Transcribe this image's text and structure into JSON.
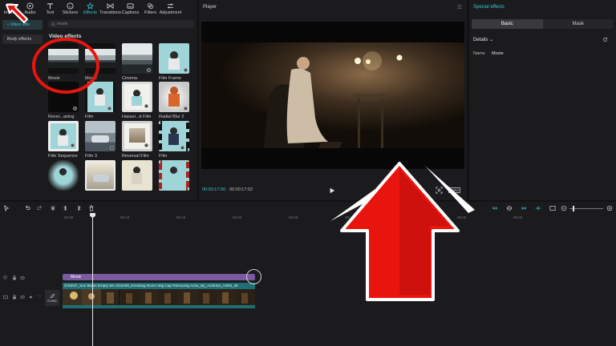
{
  "toolbar": {
    "items": [
      {
        "label": "Import",
        "icon": "import-icon"
      },
      {
        "label": "Audio",
        "icon": "audio-icon"
      },
      {
        "label": "Text",
        "icon": "text-icon"
      },
      {
        "label": "Stickers",
        "icon": "sticker-icon"
      },
      {
        "label": "Effects",
        "icon": "effects-icon",
        "active": true
      },
      {
        "label": "Transitions",
        "icon": "transitions-icon"
      },
      {
        "label": "Captions",
        "icon": "captions-icon"
      },
      {
        "label": "Filters",
        "icon": "filters-icon"
      },
      {
        "label": "Adjustment",
        "icon": "adjustment-icon"
      }
    ]
  },
  "left_nav": {
    "video_effects": "• Video effe",
    "body_effects": "Body effects"
  },
  "effects": {
    "search_value": "movie",
    "section_title": "Video effects",
    "cards": [
      {
        "label": "Movie"
      },
      {
        "label": "Movie"
      },
      {
        "label": "Cinema"
      },
      {
        "label": "Film Frame"
      },
      {
        "label": "Rever...aning"
      },
      {
        "label": "Film"
      },
      {
        "label": "Hassel...d Film"
      },
      {
        "label": "Radial Blur 2"
      },
      {
        "label": "Film Sequence"
      },
      {
        "label": "Film 3"
      },
      {
        "label": "Reversal Film"
      },
      {
        "label": "Film"
      },
      {
        "label": ""
      },
      {
        "label": ""
      },
      {
        "label": ""
      },
      {
        "label": ""
      }
    ]
  },
  "player": {
    "title": "Player",
    "current_time": "00:00:17:00",
    "total_time": "00:00:17:02",
    "ratio": "Ratio"
  },
  "right_panel": {
    "title": "Special effects",
    "tabs": [
      "Basic",
      "Mask"
    ],
    "details": "Details",
    "name_label": "Name",
    "name_value": "Movie"
  },
  "timeline": {
    "ruler": [
      "00:05",
      "00:10",
      "00:15",
      "00:20",
      "00:25",
      "00:30",
      "00:35",
      "00:40",
      "00:45"
    ],
    "effect_clip": "Movie",
    "video_clip": "2/15047_Sun Beam Empty Wo  3/15106_Dressing Room Wig Cap Removing Actor_By_Azulroto_Artlist_4K",
    "cover": "Cover"
  },
  "colors": {
    "accent": "#39c6d6",
    "effect_clip": "#7b5aa0",
    "video_clip": "#1f6e74",
    "annotation_red": "#e8150f"
  }
}
